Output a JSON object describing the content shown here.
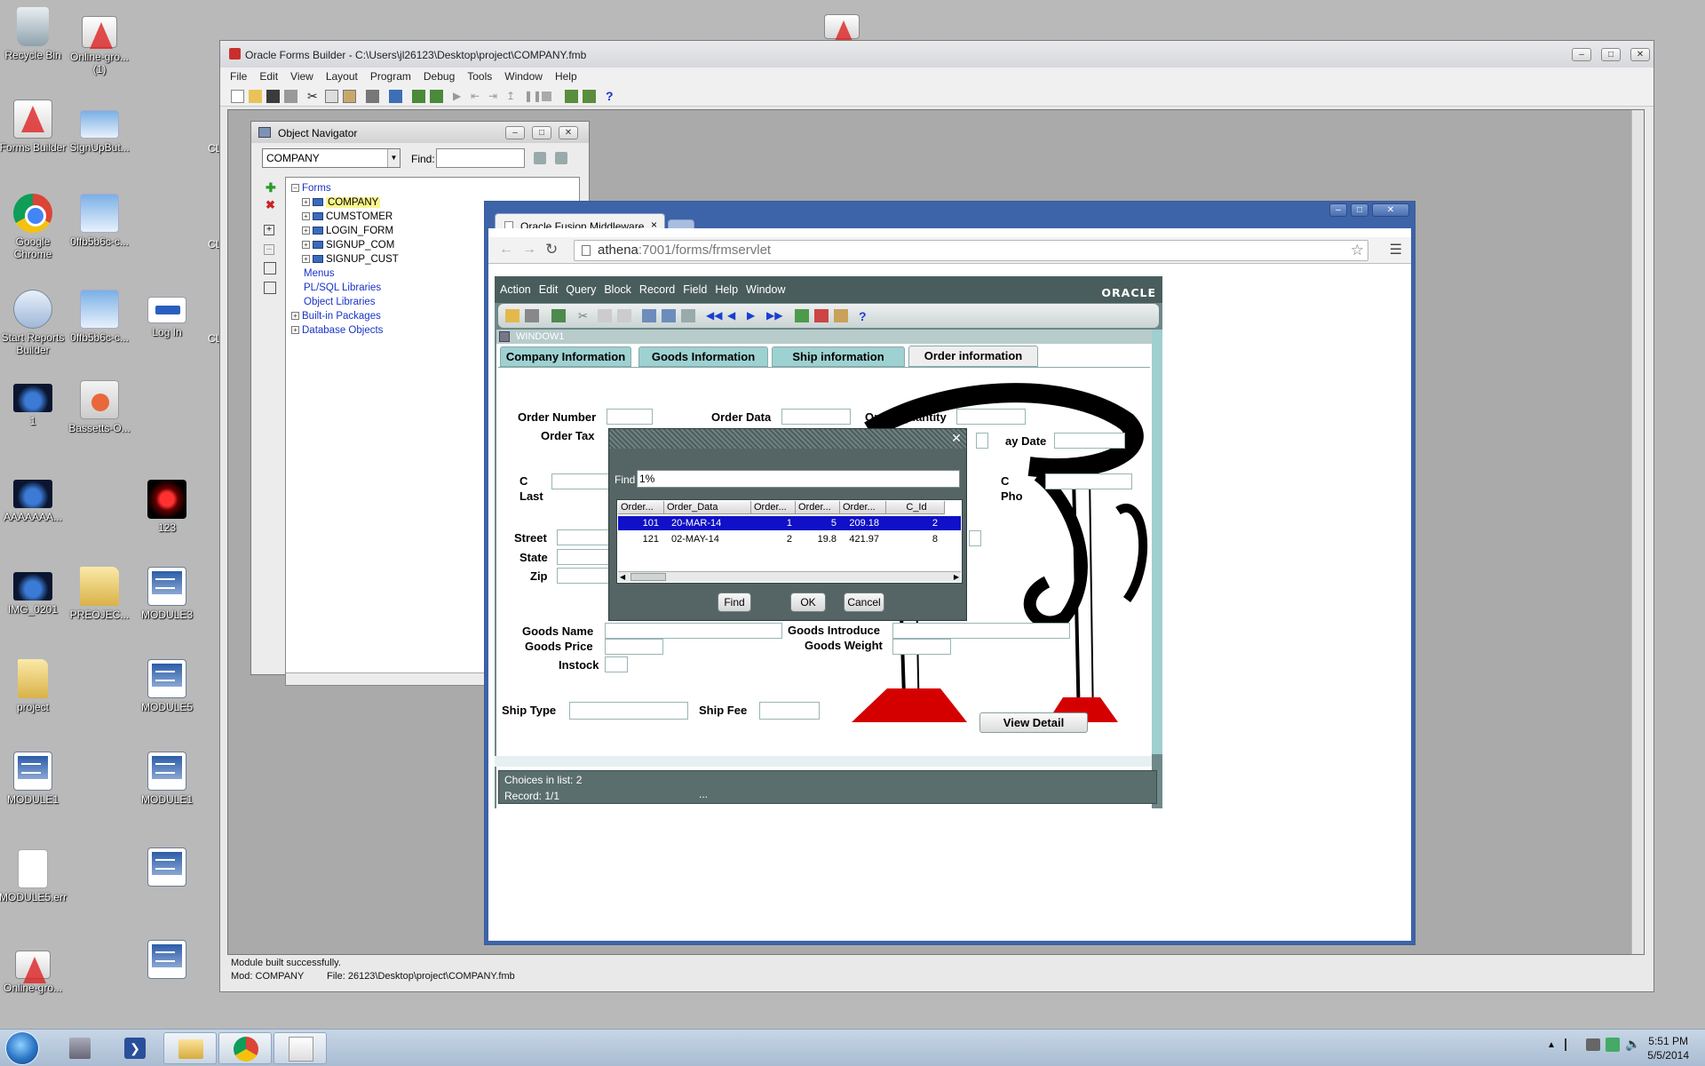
{
  "desktop": {
    "icons": [
      {
        "label": "Recycle Bin"
      },
      {
        "label": "Online-gro... (1)"
      },
      {
        "label": "Forms Builder"
      },
      {
        "label": "SignUpBut..."
      },
      {
        "label": "Google Chrome"
      },
      {
        "label": "0ffb5b6c-c..."
      },
      {
        "label": "Start Reports Builder"
      },
      {
        "label": "0ffb5b6c-c..."
      },
      {
        "label": "Log In"
      },
      {
        "label": "1"
      },
      {
        "label": "Bassetts-O..."
      },
      {
        "label": "AAAAAAA..."
      },
      {
        "label": "123"
      },
      {
        "label": "IMG_0201"
      },
      {
        "label": "PREOJEC..."
      },
      {
        "label": "MODULE3"
      },
      {
        "label": "project"
      },
      {
        "label": "MODULE5"
      },
      {
        "label": "MODULE1"
      },
      {
        "label": "MODULE1"
      },
      {
        "label": "MODULE5.err"
      },
      {
        "label": "Online-gro..."
      },
      {
        "label": "CL"
      },
      {
        "label": "CL"
      },
      {
        "label": "CL"
      }
    ]
  },
  "forms_builder": {
    "title": "Oracle Forms Builder - C:\\Users\\jl26123\\Desktop\\project\\COMPANY.fmb",
    "menu": [
      "File",
      "Edit",
      "View",
      "Layout",
      "Program",
      "Debug",
      "Tools",
      "Window",
      "Help"
    ],
    "status_message": "Module built successfully.",
    "status_module": "Mod: COMPANY",
    "status_file": "File: 26123\\Desktop\\project\\COMPANY.fmb"
  },
  "navigator": {
    "title": "Object Navigator",
    "module_select": "COMPANY",
    "find_label": "Find:",
    "find_value": "",
    "tree": {
      "forms": "Forms",
      "form_items": [
        "COMPANY",
        "CUMSTOMER",
        "LOGIN_FORM",
        "SIGNUP_COM",
        "SIGNUP_CUST"
      ],
      "others": [
        "Menus",
        "PL/SQL Libraries",
        "Object Libraries",
        "Built-in Packages",
        "Database Objects"
      ]
    }
  },
  "browser": {
    "tab_title": "Oracle Fusion Middleware",
    "url_host": "athena",
    "url_rest": ":7001/forms/frmservlet"
  },
  "forms_app": {
    "menu": [
      "Action",
      "Edit",
      "Query",
      "Block",
      "Record",
      "Field",
      "Help",
      "Window"
    ],
    "logo": "ORACLE",
    "window_title": "WINDOW1",
    "tabs": [
      "Company Information",
      "Goods Information",
      "Ship information",
      "Order information"
    ],
    "active_tab": "Order information",
    "labels": {
      "order_number": "Order Number",
      "order_data": "Order Data",
      "order_quantity": "Order Quantity",
      "order_tax": "Order Tax",
      "pay_date": "ay Date",
      "c1": "C",
      "last": "Last",
      "c2": "C",
      "pho": "Pho",
      "street": "Street",
      "state": "State",
      "zip": "Zip",
      "goods_name": "Goods Name",
      "goods_introduce": "Goods Introduce",
      "goods_price": "Goods Price",
      "goods_weight": "Goods Weight",
      "instock": "Instock",
      "ship_type": "Ship Type",
      "ship_fee": "Ship Fee"
    },
    "view_detail": "View Detail",
    "status_choices": "Choices in list: 2",
    "status_record": "Record: 1/1",
    "status_dots": "..."
  },
  "lov": {
    "find_label": "Find",
    "find_value": "1%",
    "columns": [
      "Order...",
      "Order_Data",
      "Order...",
      "Order...",
      "Order...",
      "C_Id"
    ],
    "rows": [
      [
        "101",
        "20-MAR-14",
        "1",
        "5",
        "209.18",
        "2"
      ],
      [
        "121",
        "02-MAY-14",
        "2",
        "19.8",
        "421.97",
        "8"
      ]
    ],
    "selected_row": 0,
    "find_button": "Find",
    "ok_button": "OK",
    "cancel_button": "Cancel"
  },
  "taskbar": {
    "time": "5:51 PM",
    "date": "5/5/2014"
  }
}
